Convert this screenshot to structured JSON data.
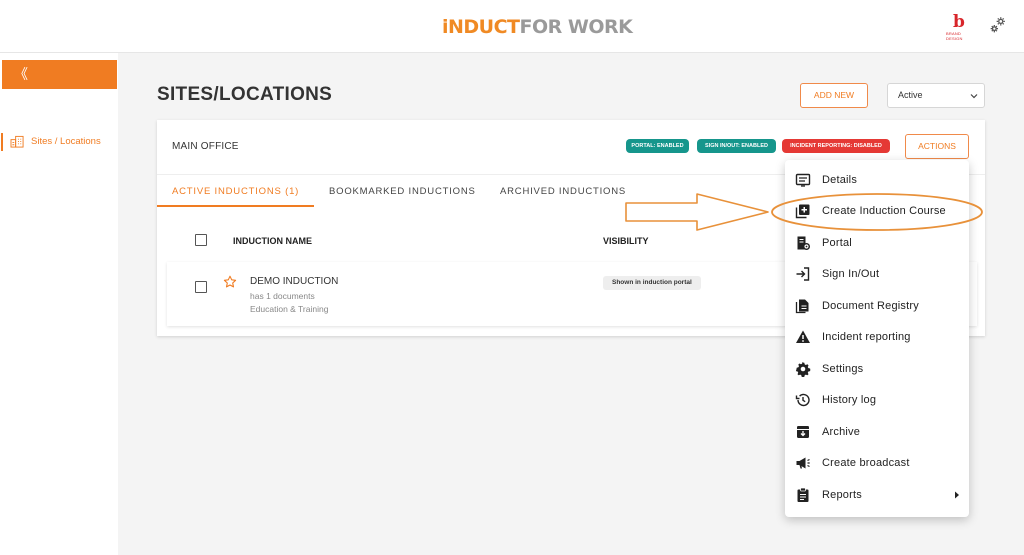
{
  "header": {
    "logo_part1": "iNDUCT",
    "logo_part2": "FOR WORK",
    "brand_letter": "b",
    "brand_caption": "BRAND DESIGN"
  },
  "sidebar": {
    "collapse_glyph": "《",
    "items": [
      {
        "label": "Sites / Locations",
        "icon": "building-icon"
      }
    ]
  },
  "page": {
    "title": "SITES/LOCATIONS",
    "add_new_label": "ADD NEW",
    "status_select_value": "Active"
  },
  "site": {
    "name": "MAIN OFFICE",
    "badges": {
      "portal": "PORTAL: ENABLED",
      "sign_in_out": "SIGN IN/OUT: ENABLED",
      "incident": "INCIDENT REPORTING: DISABLED"
    },
    "actions_label": "ACTIONS"
  },
  "tabs": [
    {
      "label": "ACTIVE INDUCTIONS  (1)"
    },
    {
      "label": "BOOKMARKED INDUCTIONS"
    },
    {
      "label": "ARCHIVED INDUCTIONS"
    }
  ],
  "table": {
    "columns": [
      "INDUCTION NAME",
      "VISIBILITY"
    ],
    "rows": [
      {
        "name": "DEMO INDUCTION",
        "documents": "has 1 documents",
        "category": "Education & Training",
        "visibility": "Shown in induction portal"
      }
    ]
  },
  "menu": {
    "items": [
      {
        "label": "Details",
        "icon": "details-icon"
      },
      {
        "label": "Create Induction Course",
        "icon": "add-box-icon"
      },
      {
        "label": "Portal",
        "icon": "portal-icon"
      },
      {
        "label": "Sign In/Out",
        "icon": "login-icon"
      },
      {
        "label": "Document Registry",
        "icon": "document-icon"
      },
      {
        "label": "Incident reporting",
        "icon": "warning-icon"
      },
      {
        "label": "Settings",
        "icon": "gear-icon"
      },
      {
        "label": "History log",
        "icon": "history-icon"
      },
      {
        "label": "Archive",
        "icon": "archive-icon"
      },
      {
        "label": "Create broadcast",
        "icon": "megaphone-icon"
      },
      {
        "label": "Reports",
        "icon": "clipboard-icon"
      }
    ]
  },
  "colors": {
    "accent": "#f07c22",
    "teal_badge": "#16968c",
    "red_badge": "#e53935"
  }
}
